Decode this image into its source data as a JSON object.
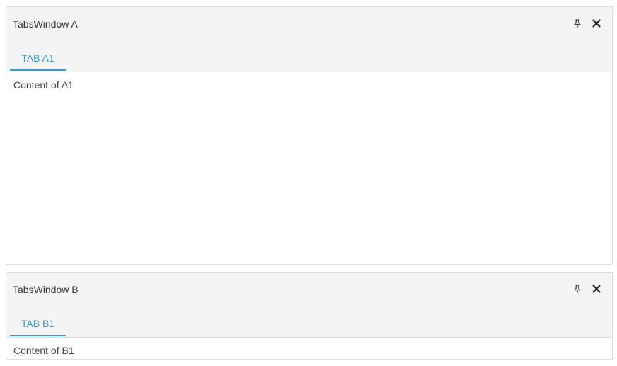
{
  "windows": [
    {
      "title": "TabsWindow A",
      "icons": [
        "pin-icon",
        "close-icon"
      ],
      "tabs": [
        {
          "label": "TAB A1",
          "active": true
        }
      ],
      "content": "Content of A1"
    },
    {
      "title": "TabsWindow B",
      "icons": [
        "pin-icon",
        "close-icon"
      ],
      "tabs": [
        {
          "label": "TAB B1",
          "active": true
        }
      ],
      "content": "Content of B1"
    }
  ],
  "colors": {
    "accent": "#3498db",
    "header_bg": "#f4f4f4",
    "border": "#dcdcdc",
    "text": "#333333"
  }
}
